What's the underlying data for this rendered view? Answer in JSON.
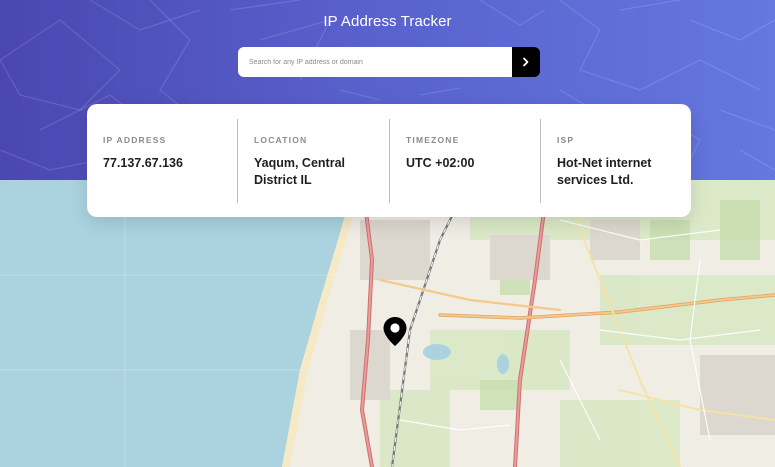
{
  "app": {
    "title": "IP Address Tracker"
  },
  "search": {
    "placeholder": "Search for any IP address or domain",
    "submit_icon": "chevron-right-icon"
  },
  "info": {
    "ip": {
      "label": "IP ADDRESS",
      "value": "77.137.67.136"
    },
    "location": {
      "label": "LOCATION",
      "value": "Yaqum, Central District IL"
    },
    "timezone": {
      "label": "TIMEZONE",
      "value": "UTC +02:00"
    },
    "isp": {
      "label": "ISP",
      "value": "Hot-Net internet services Ltd."
    }
  },
  "map": {
    "marker_icon": "location-pin-icon"
  },
  "colors": {
    "header_start": "#4a47b0",
    "header_end": "#6478e0",
    "button": "#000000",
    "sea": "#aad3df",
    "land": "#f2efe9"
  }
}
